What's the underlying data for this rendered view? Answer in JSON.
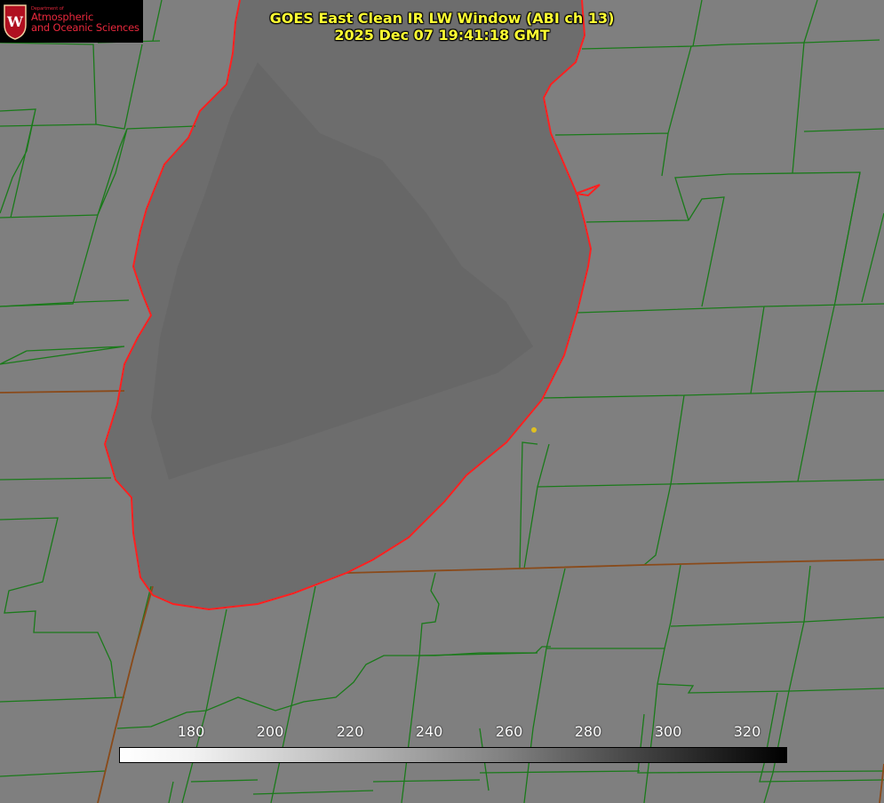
{
  "header": {
    "title_line1": "GOES East Clean IR LW Window (ABI ch 13)",
    "title_line2": "2025 Dec 07 19:41:18 GMT",
    "text_color": "#ffff33"
  },
  "logo": {
    "department": "Department of",
    "line1": "Atmospheric",
    "line2": "and Oceanic Sciences",
    "seal_letter": "W",
    "color": "#e8283c",
    "background": "#000000"
  },
  "map": {
    "background": "#7f7f7f",
    "lake_fill": "#6d6d6d",
    "county_line_color": "#1a7a1a",
    "state_line_color": "#8a4a1a",
    "coastline_color": "#ff2020",
    "marker_color": "#e0c020"
  },
  "colorbar": {
    "ticks": [
      "180",
      "200",
      "220",
      "240",
      "260",
      "280",
      "300",
      "320"
    ],
    "gradient_from": "#ffffff",
    "gradient_to": "#000000"
  }
}
